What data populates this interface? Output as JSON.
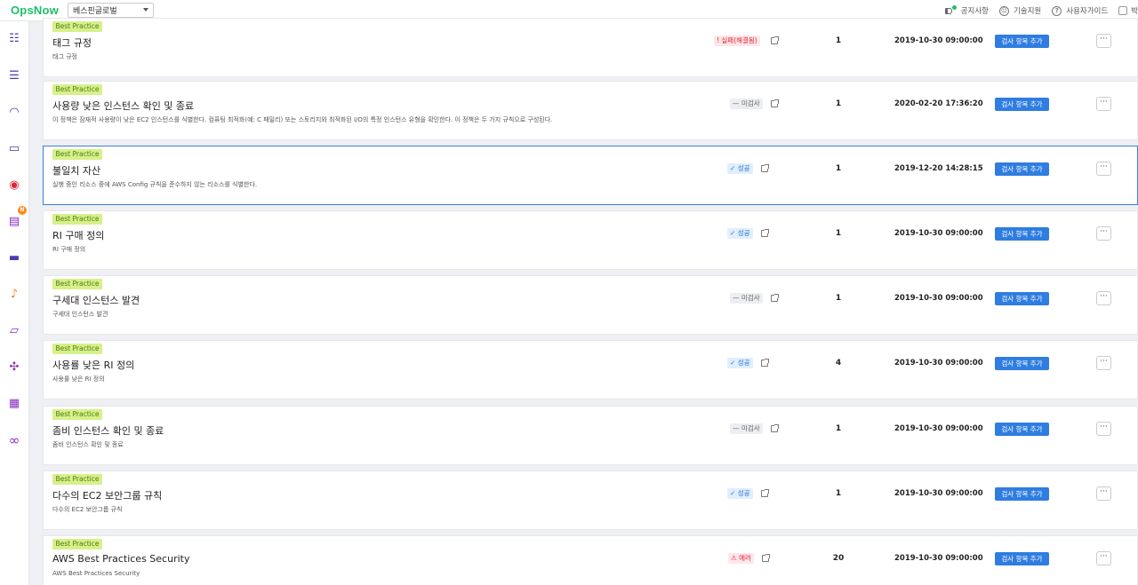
{
  "app": {
    "logo": "OpsNow",
    "workspace": "베스핀글로벌"
  },
  "top_nav": [
    {
      "label": "공지사항",
      "icon": "megaphone-icon"
    },
    {
      "label": "기술지원",
      "icon": "support-icon"
    },
    {
      "label": "사용자가이드",
      "icon": "help-icon"
    },
    {
      "label": "박",
      "icon": "user-icon"
    }
  ],
  "sidebar": {
    "items": [
      {
        "icon": "dashboard-icon",
        "glyph": "☷"
      },
      {
        "icon": "list-icon",
        "glyph": "☰"
      },
      {
        "icon": "gauge-icon",
        "glyph": "◠"
      },
      {
        "icon": "monitor-check-icon",
        "glyph": "▭"
      },
      {
        "icon": "broadcast-icon",
        "glyph": "◉"
      },
      {
        "icon": "message-icon",
        "glyph": "▤"
      },
      {
        "icon": "laptop-icon",
        "glyph": "▬"
      },
      {
        "icon": "bell-icon",
        "glyph": "♪"
      },
      {
        "icon": "screen-cursor-icon",
        "glyph": "▱"
      },
      {
        "icon": "arrows-icon",
        "glyph": "✣"
      },
      {
        "icon": "server-icon",
        "glyph": "▦"
      },
      {
        "icon": "infinity-icon",
        "glyph": "∞"
      }
    ],
    "badge": "N"
  },
  "colors": {
    "brand": "#1fbf6a",
    "primary_button": "#2f7de1",
    "tag_bg": "#d7f08a",
    "fail": "#e0243a",
    "ok": "#2a6fd6"
  },
  "rows": [
    {
      "tag": "Best Practice",
      "title": "태그 규정",
      "desc": "태그 규정",
      "status": "실패(해결됨)",
      "status_type": "fail",
      "status_icon": "!",
      "count": "1",
      "date": "2019-10-30 09:00:00",
      "button": "검사 항목 추가"
    },
    {
      "tag": "Best Practice",
      "title": "사용량 낮은 인스턴스 확인 및 종료",
      "desc": "이 정책은 잠재적 사용량이 낮은 EC2 인스턴스를 식별한다. 컴퓨팅 최적화(예: C 패밀리) 또는 스토리지와 최적화된 I/O의 특정 인스턴스 유형을 확인한다. 이 정책은 두 가지 규칙으로 구성된다.",
      "status": "미검사",
      "status_type": "none",
      "status_icon": "—",
      "count": "1",
      "date": "2020-02-20 17:36:20",
      "button": "검사 항목 추가"
    },
    {
      "tag": "Best Practice",
      "title": "불일치 자산",
      "desc": "실행 중인 리소스 중에 AWS Config 규칙을 준수하지 않는 리소스를 식별한다.",
      "status": "성공",
      "status_type": "ok",
      "status_icon": "✓",
      "count": "1",
      "date": "2019-12-20 14:28:15",
      "button": "검사 항목 추가"
    },
    {
      "tag": "Best Practice",
      "title": "RI 구매 정의",
      "desc": "RI 구매 정의",
      "status": "성공",
      "status_type": "ok",
      "status_icon": "✓",
      "count": "1",
      "date": "2019-10-30 09:00:00",
      "button": "검사 항목 추가"
    },
    {
      "tag": "Best Practice",
      "title": "구세대 인스턴스 발견",
      "desc": "구세대 인스턴스 발견",
      "status": "미검사",
      "status_type": "none",
      "status_icon": "—",
      "count": "1",
      "date": "2019-10-30 09:00:00",
      "button": "검사 항목 추가"
    },
    {
      "tag": "Best Practice",
      "title": "사용률 낮은 RI 정의",
      "desc": "사용률 낮은 RI 정의",
      "status": "성공",
      "status_type": "ok",
      "status_icon": "✓",
      "count": "4",
      "date": "2019-10-30 09:00:00",
      "button": "검사 항목 추가"
    },
    {
      "tag": "Best Practice",
      "title": "좀비 인스턴스 확인 및 종료",
      "desc": "좀비 인스턴스 확인 및 종료",
      "status": "미검사",
      "status_type": "none",
      "status_icon": "—",
      "count": "1",
      "date": "2019-10-30 09:00:00",
      "button": "검사 항목 추가"
    },
    {
      "tag": "Best Practice",
      "title": "다수의 EC2 보안그룹 규칙",
      "desc": "다수의 EC2 보안그룹 규칙",
      "status": "성공",
      "status_type": "ok",
      "status_icon": "✓",
      "count": "1",
      "date": "2019-10-30 09:00:00",
      "button": "검사 항목 추가"
    },
    {
      "tag": "Best Practice",
      "title": "AWS Best Practices Security",
      "desc": "AWS Best Practices Security",
      "status": "에러",
      "status_type": "err",
      "status_icon": "⚠",
      "count": "20",
      "date": "2019-10-30 09:00:00",
      "button": "검사 항목 추가"
    }
  ],
  "more_label": "···"
}
